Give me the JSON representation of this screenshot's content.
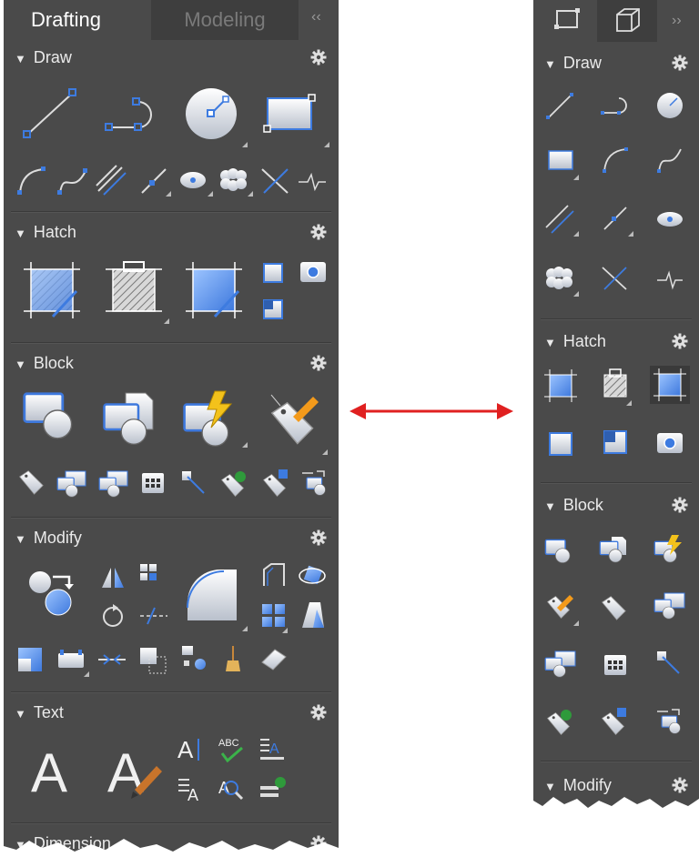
{
  "left_panel": {
    "tabs": [
      {
        "label": "Drafting",
        "active": true
      },
      {
        "label": "Modeling",
        "active": false
      }
    ],
    "collapse_label": "‹‹",
    "sections": {
      "draw": "Draw",
      "hatch": "Hatch",
      "block": "Block",
      "modify": "Modify",
      "text": "Text",
      "dimension": "Dimension"
    }
  },
  "right_panel": {
    "tabs": [
      {
        "icon": "drafting-tab-icon",
        "active": false
      },
      {
        "icon": "modeling-tab-icon",
        "active": true
      }
    ],
    "expand_label": "››",
    "sections": {
      "draw": "Draw",
      "hatch": "Hatch",
      "block": "Block",
      "modify": "Modify"
    }
  },
  "arrow": {
    "color": "#e02020",
    "meaning": "double-arrow"
  },
  "colors": {
    "panel_bg": "#4a4a4a",
    "accent_blue": "#3d7be0",
    "text": "#e8e8e8"
  }
}
